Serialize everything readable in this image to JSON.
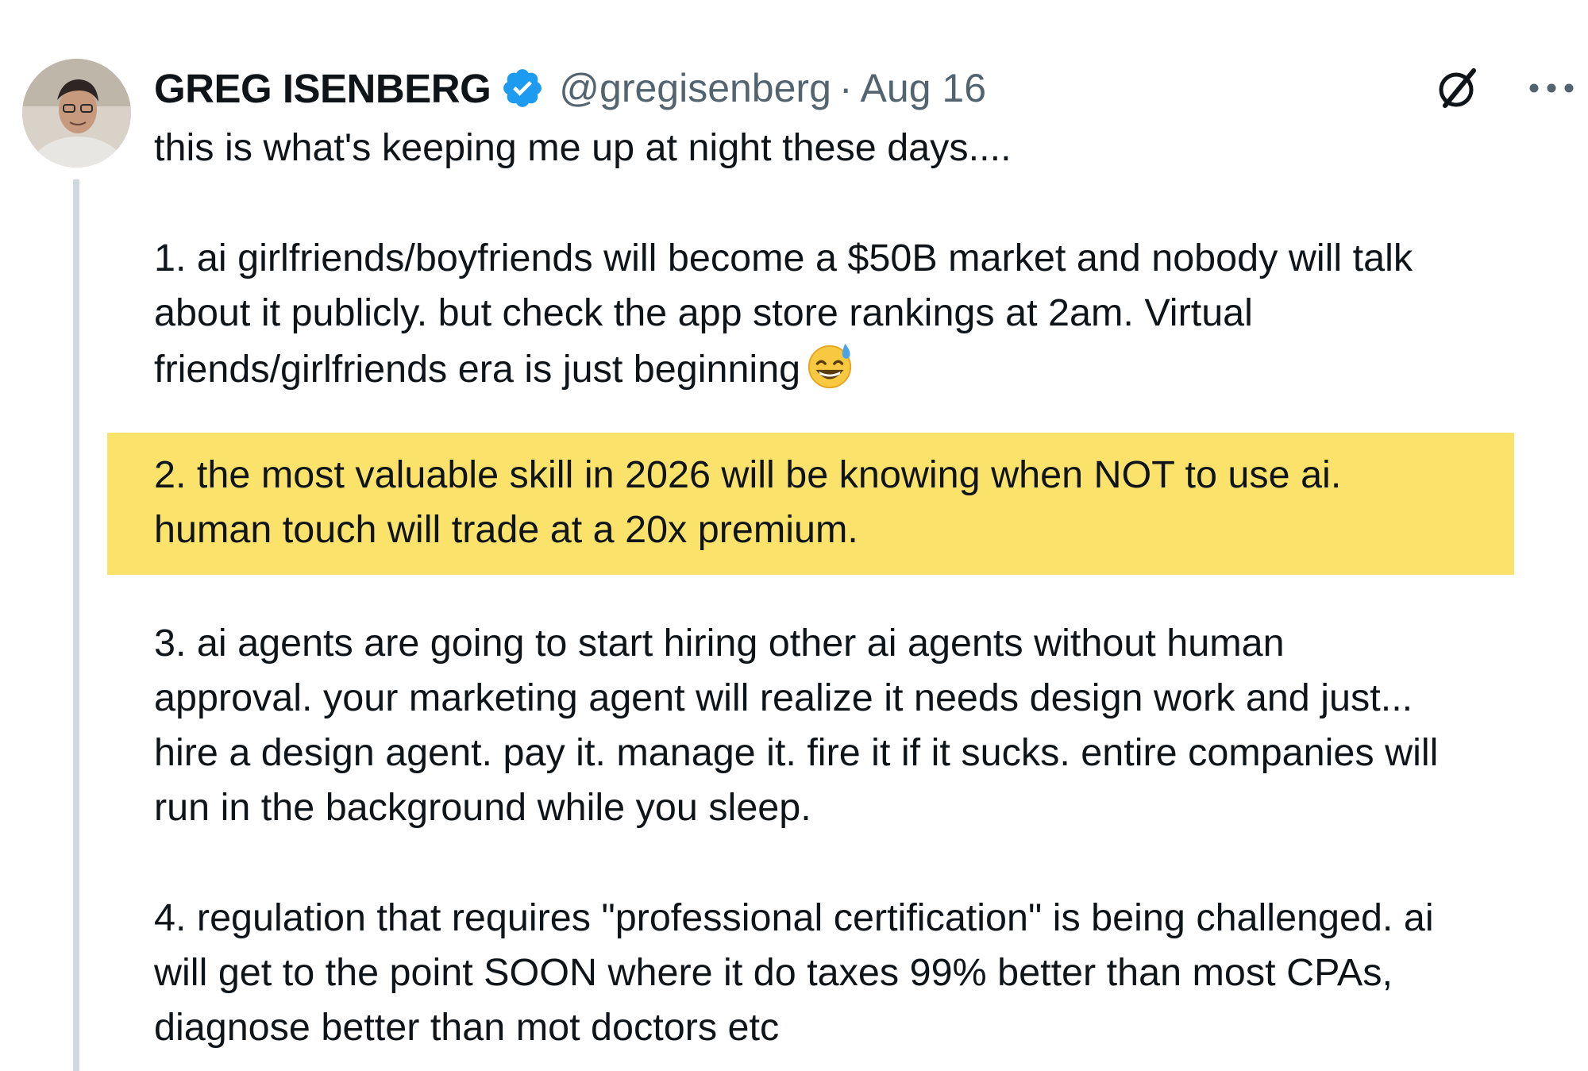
{
  "author": {
    "name": "GREG ISENBERG",
    "handle": "@gregisenberg",
    "separator": "·",
    "date": "Aug 16",
    "verified_icon": "verified-badge-icon",
    "avatar_icon": "avatar-photo"
  },
  "actions": {
    "grok_icon": "grok-icon",
    "more_icon": "more-options-icon"
  },
  "tweet": {
    "intro": "this is what's keeping me up at night these days....",
    "point1": {
      "line1": "1. ai girlfriends/boyfriends will become a $50B market and nobody will talk",
      "line2": "about it publicly. but check the app store rankings at 2am. Virtual",
      "line3": "friends/girlfriends era is just beginning",
      "emoji": "😅"
    },
    "point2": {
      "line1": "2. the most valuable skill in 2026 will be knowing when NOT to use ai.",
      "line2": "human touch will trade at a 20x premium."
    },
    "point3": {
      "line1": "3. ai agents are going to start hiring other ai agents without human",
      "line2": "approval. your marketing agent will realize it needs design work and just...",
      "line3": "hire a design agent. pay it. manage it. fire it if it sucks. entire companies will",
      "line4": "run in the background while you sleep."
    },
    "point4": {
      "line1": "4. regulation that requires \"professional certification\" is being challenged. ai",
      "line2": "will get to the point SOON where it do taxes 99% better than most CPAs,",
      "line3": "diagnose better than mot doctors etc"
    }
  },
  "colors": {
    "highlight": "#fbe26b",
    "verified": "#1d9bf0",
    "text": "#0f1419",
    "secondary": "#536471",
    "thread_line": "#cfd9de"
  }
}
